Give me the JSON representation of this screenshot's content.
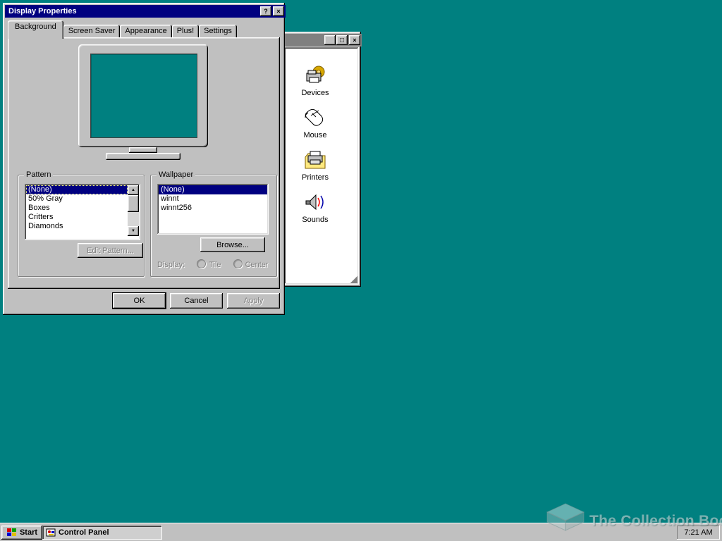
{
  "desktop": {
    "background_color": "#008080",
    "titlebar_active_color": "#000080"
  },
  "icons_glyphs": {
    "help": "?",
    "close": "×",
    "minimize": "_",
    "maximize": "□",
    "scroll_up": "▲",
    "scroll_down": "▼"
  },
  "display_properties": {
    "title": "Display Properties",
    "tabs": [
      {
        "label": "Background",
        "active": true
      },
      {
        "label": "Screen Saver",
        "active": false
      },
      {
        "label": "Appearance",
        "active": false
      },
      {
        "label": "Plus!",
        "active": false
      },
      {
        "label": "Settings",
        "active": false
      }
    ],
    "pattern": {
      "label": "Pattern",
      "items": [
        "(None)",
        "50% Gray",
        "Boxes",
        "Critters",
        "Diamonds"
      ],
      "selected_index": 0,
      "edit_button_label": "Edit Pattern...",
      "edit_button_enabled": false
    },
    "wallpaper": {
      "label": "Wallpaper",
      "items": [
        "(None)",
        "winnt",
        "winnt256"
      ],
      "selected_index": 0,
      "browse_button_label": "Browse...",
      "display_label": "Display:",
      "tile_label": "Tile",
      "center_label": "Center",
      "display_options_enabled": false
    },
    "buttons": {
      "ok": "OK",
      "cancel": "Cancel",
      "apply": "Apply",
      "apply_enabled": false
    }
  },
  "control_panel": {
    "icons": [
      {
        "label": "Devices"
      },
      {
        "label": "Mouse"
      },
      {
        "label": "Printers"
      },
      {
        "label": "Sounds"
      }
    ]
  },
  "taskbar": {
    "start_label": "Start",
    "tasks": [
      {
        "label": "Control Panel",
        "active": true
      }
    ],
    "clock": "7:21 AM"
  },
  "watermark": {
    "text": "The Collection Book"
  }
}
